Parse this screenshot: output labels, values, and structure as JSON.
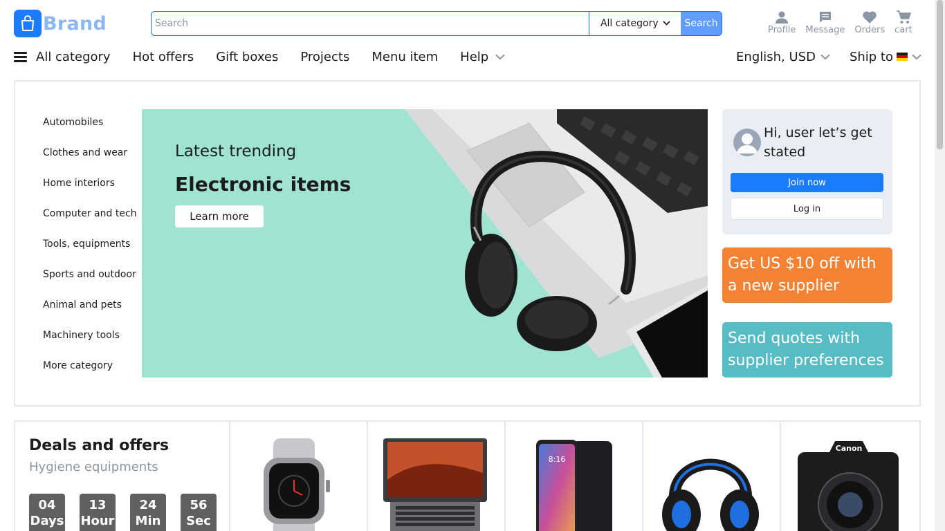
{
  "header": {
    "brand": "Brand",
    "search": {
      "placeholder": "Search",
      "category": "All category",
      "button": "Search"
    },
    "actions": [
      {
        "label": "Profile",
        "icon": "person-icon"
      },
      {
        "label": "Message",
        "icon": "message-icon"
      },
      {
        "label": "Orders",
        "icon": "heart-icon"
      },
      {
        "label": "cart",
        "icon": "cart-icon"
      }
    ]
  },
  "nav": {
    "items": [
      "All category",
      "Hot offers",
      "Gift boxes",
      "Projects",
      "Menu item",
      "Help"
    ],
    "language": "English, USD",
    "ship_to": "Ship to"
  },
  "hero": {
    "categories": [
      "Automobiles",
      "Clothes and wear",
      "Home interiors",
      "Computer and tech",
      "Tools, equipments",
      "Sports and outdoor",
      "Animal and pets",
      "Machinery tools",
      "More category"
    ],
    "banner": {
      "subtitle": "Latest trending",
      "title": "Electronic items",
      "button": "Learn more"
    },
    "user": {
      "greeting": "Hi, user let’s get stated",
      "join": "Join now",
      "login": "Log in"
    },
    "promos": [
      "Get US $10 off with a new supplier",
      "Send quotes with supplier preferences"
    ],
    "colors": {
      "accent": "#1b7cfe",
      "promo_orange": "#f38332",
      "promo_teal": "#55bdc3",
      "banner_bg": "#9fe3d0"
    }
  },
  "deals": {
    "title": "Deals and offers",
    "subtitle": "Hygiene equipments",
    "timer": [
      {
        "value": "04",
        "unit": "Days"
      },
      {
        "value": "13",
        "unit": "Hour"
      },
      {
        "value": "24",
        "unit": "Min"
      },
      {
        "value": "56",
        "unit": "Sec"
      }
    ],
    "products": [
      "smartwatch-image",
      "laptop-image",
      "smartphone-image",
      "gaming-headset-image",
      "camera-image"
    ]
  }
}
